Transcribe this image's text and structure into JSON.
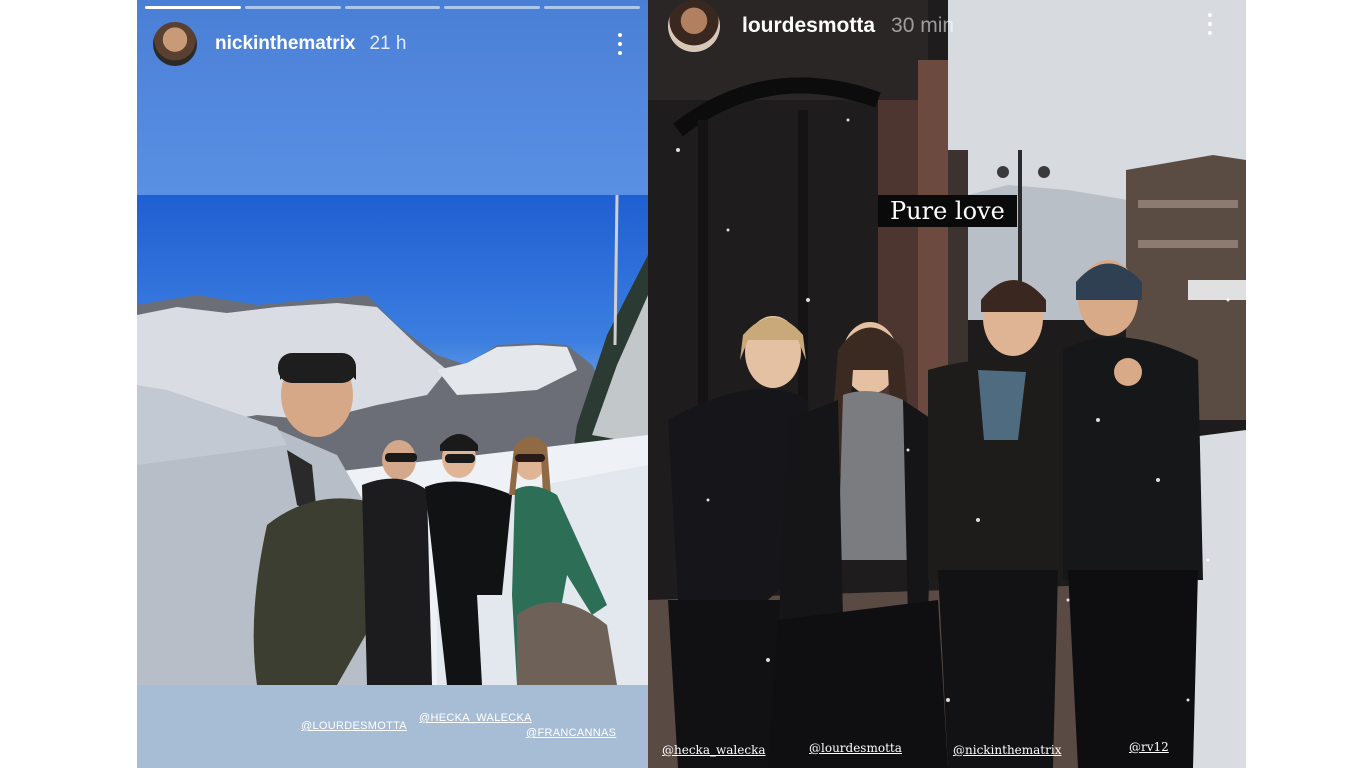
{
  "story1": {
    "username": "nickinthematrix",
    "time": "21 h",
    "progress_done_segments": 1,
    "progress_total_segments": 5,
    "mentions": [
      "@LOURDESMOTTA",
      "@HECKA_WALECKA",
      "@FRANCANNAS"
    ]
  },
  "story2": {
    "username": "lourdesmotta",
    "time": "30 min",
    "caption": "Pure love",
    "mentions": [
      "@hecka_walecka",
      "@lourdesmotta",
      "@nickinthematrix",
      "@rv12"
    ]
  },
  "colors": {
    "story1_bg": "#5a90e4",
    "story2_bg": "#1d1b1b",
    "caption_bg": "#0a0a0a"
  },
  "icons": [
    "more-vertical-icon"
  ]
}
